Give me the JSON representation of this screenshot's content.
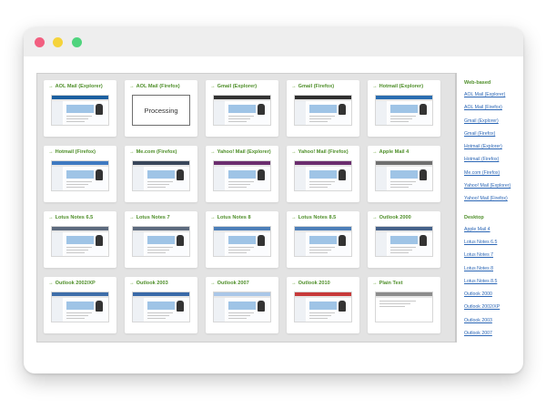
{
  "window": {
    "controls": [
      "close",
      "minimize",
      "maximize"
    ]
  },
  "grid": {
    "items": [
      {
        "title": "AOL Mail (Explorer)",
        "processing": false,
        "accent": "#1b5fa0"
      },
      {
        "title": "AOL Mail (Firefox)",
        "processing": true,
        "processing_text": "Processing",
        "accent": "#ffffff"
      },
      {
        "title": "Gmail (Explorer)",
        "processing": false,
        "accent": "#333333"
      },
      {
        "title": "Gmail (Firefox)",
        "processing": false,
        "accent": "#2f2f2f"
      },
      {
        "title": "Hotmail (Explorer)",
        "processing": false,
        "accent": "#2a6db0"
      },
      {
        "title": "Hotmail (Firefox)",
        "processing": false,
        "accent": "#3e79c1"
      },
      {
        "title": "Me.com (Firefox)",
        "processing": false,
        "accent": "#39465a"
      },
      {
        "title": "Yahoo! Mail (Explorer)",
        "processing": false,
        "accent": "#6b2d6e"
      },
      {
        "title": "Yahoo! Mail (Firefox)",
        "processing": false,
        "accent": "#6b2d6e"
      },
      {
        "title": "Apple Mail 4",
        "processing": false,
        "accent": "#6f6f6f"
      },
      {
        "title": "Lotus Notes 6.5",
        "processing": false,
        "accent": "#5d6b7e"
      },
      {
        "title": "Lotus Notes 7",
        "processing": false,
        "accent": "#5d6b7e"
      },
      {
        "title": "Lotus Notes 8",
        "processing": false,
        "accent": "#4d7fb8"
      },
      {
        "title": "Lotus Notes 8.5",
        "processing": false,
        "accent": "#4d7fb8"
      },
      {
        "title": "Outlook 2000",
        "processing": false,
        "accent": "#46628a"
      },
      {
        "title": "Outlook 2002/XP",
        "processing": false,
        "accent": "#3f6ea9"
      },
      {
        "title": "Outlook 2003",
        "processing": false,
        "accent": "#3a6aa8"
      },
      {
        "title": "Outlook 2007",
        "processing": false,
        "accent": "#aac7e8"
      },
      {
        "title": "Outlook 2010",
        "processing": false,
        "accent": "#c73a3a"
      },
      {
        "title": "Plain Text",
        "processing": false,
        "plain": true,
        "accent": "#8c8c8c"
      }
    ]
  },
  "sidebar": {
    "webbased_heading": "Web-based",
    "webbased_links": [
      "AOL Mail (Explorer)",
      "AOL Mail (Firefox)",
      "Gmail (Explorer)",
      "Gmail (Firefox)",
      "Hotmail (Explorer)",
      "Hotmail (Firefox)",
      "Me.com (Firefox)",
      "Yahoo! Mail (Explorer)",
      "Yahoo! Mail (Firefox)"
    ],
    "desktop_heading": "Desktop",
    "desktop_links": [
      "Apple Mail 4",
      "Lotus Notes 6.5",
      "Lotus Notes 7",
      "Lotus Notes 8",
      "Lotus Notes 8.5",
      "Outlook 2000",
      "Outlook 2002/XP",
      "Outlook 2003",
      "Outlook 2007"
    ]
  },
  "colors": {
    "title_green": "#4f8f2a",
    "link_blue": "#2b66b5",
    "window_bar": "#eeeeee"
  }
}
